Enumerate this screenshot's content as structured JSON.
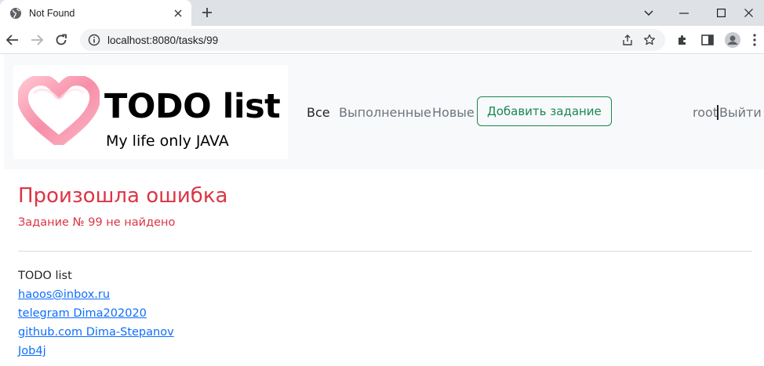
{
  "browser": {
    "tab_title": "Not Found",
    "url": "localhost:8080/tasks/99"
  },
  "brand": {
    "title": "TODO list",
    "subtitle": "My life only JAVA"
  },
  "nav": {
    "items": [
      {
        "label": "Все",
        "active": true
      },
      {
        "label": "Выполненные",
        "active": false
      },
      {
        "label": "Новые",
        "active": false
      }
    ],
    "add_button": "Добавить задание",
    "user": "root",
    "logout": "Выйти"
  },
  "error": {
    "title": "Произошла ошибка",
    "message": "Задание № 99 не найдено"
  },
  "footer": {
    "title": "TODO list",
    "links": [
      "haoos@inbox.ru",
      "telegram Dima202020",
      "github.com Dima-Stepanov",
      "Job4j"
    ]
  },
  "colors": {
    "danger": "#dc3545",
    "success": "#198754",
    "link": "#0d6efd",
    "heart": "#f7a1b5"
  }
}
